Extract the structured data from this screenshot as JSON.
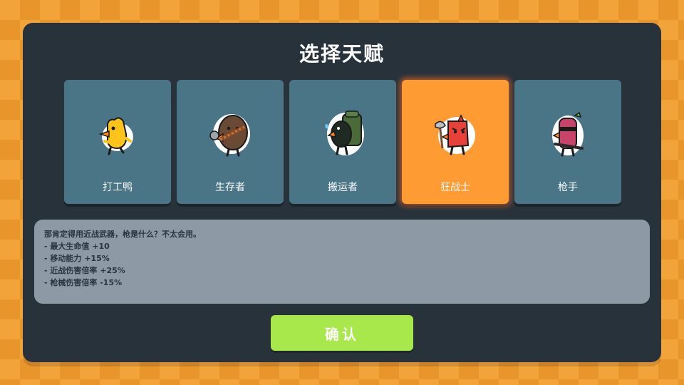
{
  "title": "选择天赋",
  "cards": [
    {
      "label": "打工鸭",
      "icon": "yellow-duck-icon",
      "selected": false
    },
    {
      "label": "生存者",
      "icon": "brown-survivor-icon",
      "selected": false
    },
    {
      "label": "搬运者",
      "icon": "green-backpack-bird-icon",
      "selected": false
    },
    {
      "label": "狂战士",
      "icon": "red-berserker-bird-icon",
      "selected": true
    },
    {
      "label": "枪手",
      "icon": "pink-gunner-icon",
      "selected": false
    }
  ],
  "description": {
    "lines": [
      "那肯定得用近战武器，枪是什么？不太会用。",
      "- 最大生命值 +10",
      "- 移动能力 +15%",
      "- 近战伤害倍率 +25%",
      "- 枪械伤害倍率 -15%"
    ]
  },
  "confirm_label": "确认",
  "colors": {
    "panel": "#27323b",
    "card": "#4a7586",
    "card_selected": "#ff9b33",
    "description_bg": "#8d9aa5",
    "confirm_button": "#a8e84a",
    "background": "#f2a43a"
  }
}
